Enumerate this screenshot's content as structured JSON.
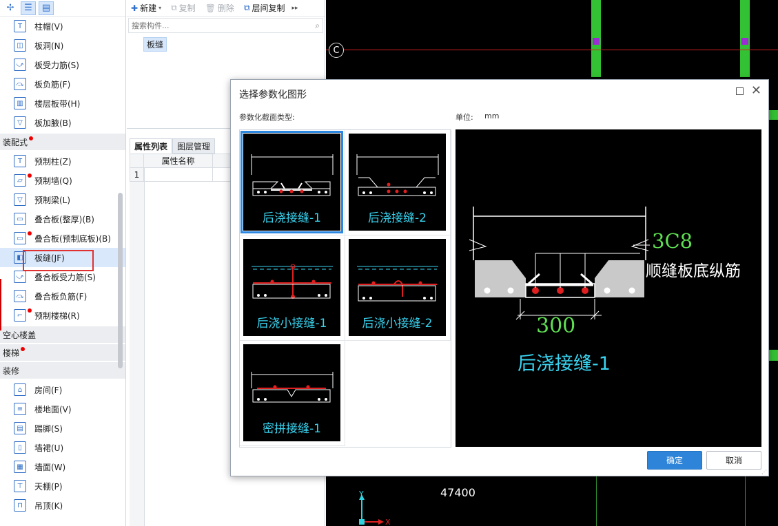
{
  "left_panel": {
    "items_top": [
      {
        "label": "柱帽(V)",
        "icon": "column-cap-icon"
      },
      {
        "label": "板洞(N)",
        "icon": "slab-hole-icon"
      },
      {
        "label": "板受力筋(S)",
        "icon": "slab-rebar-icon"
      },
      {
        "label": "板负筋(F)",
        "icon": "slab-negative-rebar-icon"
      },
      {
        "label": "楼层板带(H)",
        "icon": "slab-strip-icon"
      },
      {
        "label": "板加腋(B)",
        "icon": "slab-haunch-icon"
      }
    ],
    "group_prefab": "装配式",
    "items_prefab": [
      {
        "label": "预制柱(Z)",
        "icon": "prefab-column-icon"
      },
      {
        "label": "预制墙(Q)",
        "icon": "prefab-wall-icon"
      },
      {
        "label": "预制梁(L)",
        "icon": "prefab-beam-icon"
      },
      {
        "label": "叠合板(整厚)(B)",
        "icon": "composite-slab-icon"
      },
      {
        "label": "叠合板(预制底板)(B)",
        "icon": "composite-slab-bottom-icon"
      },
      {
        "label": "板缝(JF)",
        "icon": "slab-joint-icon"
      },
      {
        "label": "叠合板受力筋(S)",
        "icon": "composite-rebar-icon"
      },
      {
        "label": "叠合板负筋(F)",
        "icon": "composite-negative-rebar-icon"
      },
      {
        "label": "预制楼梯(R)",
        "icon": "prefab-stair-icon"
      }
    ],
    "group_hollow": "空心楼盖",
    "group_stair": "楼梯",
    "group_deco": "装修",
    "items_deco": [
      {
        "label": "房间(F)",
        "icon": "room-icon"
      },
      {
        "label": "楼地面(V)",
        "icon": "floor-icon"
      },
      {
        "label": "踢脚(S)",
        "icon": "skirting-icon"
      },
      {
        "label": "墙裙(U)",
        "icon": "dado-icon"
      },
      {
        "label": "墙面(W)",
        "icon": "wall-surface-icon"
      },
      {
        "label": "天棚(P)",
        "icon": "ceiling-icon"
      },
      {
        "label": "吊顶(K)",
        "icon": "suspended-ceiling-icon"
      }
    ]
  },
  "mid_panel": {
    "new_label": "新建",
    "copy_label": "复制",
    "delete_label": "删除",
    "floor_copy_label": "层间复制",
    "search_placeholder": "搜索构件...",
    "component": "板缝",
    "tab_props": "属性列表",
    "tab_layers": "图层管理",
    "col_prop_name": "属性名称",
    "row_num": "1"
  },
  "cad": {
    "axis_label": "C",
    "dimension": "47400",
    "ucs_y": "Y",
    "ucs_x": "X"
  },
  "dialog": {
    "title": "选择参数化图形",
    "type_label": "参数化截面类型:",
    "unit_label": "单位:",
    "unit_value": "mm",
    "thumbs": [
      "后浇接缝-1",
      "后浇接缝-2",
      "后浇小接缝-1",
      "后浇小接缝-2",
      "密拼接缝-1"
    ],
    "preview": {
      "title": "后浇接缝-1",
      "dim_width": "300",
      "dim_rebar": "3C8",
      "rebar_label": "顺缝板底纵筋"
    },
    "ok_label": "确定",
    "cancel_label": "取消"
  },
  "colors": {
    "accent": "#2d84d8",
    "cad_cyan": "#38d3ef",
    "cad_green": "#5ee052",
    "rebar_red": "#e02020"
  }
}
